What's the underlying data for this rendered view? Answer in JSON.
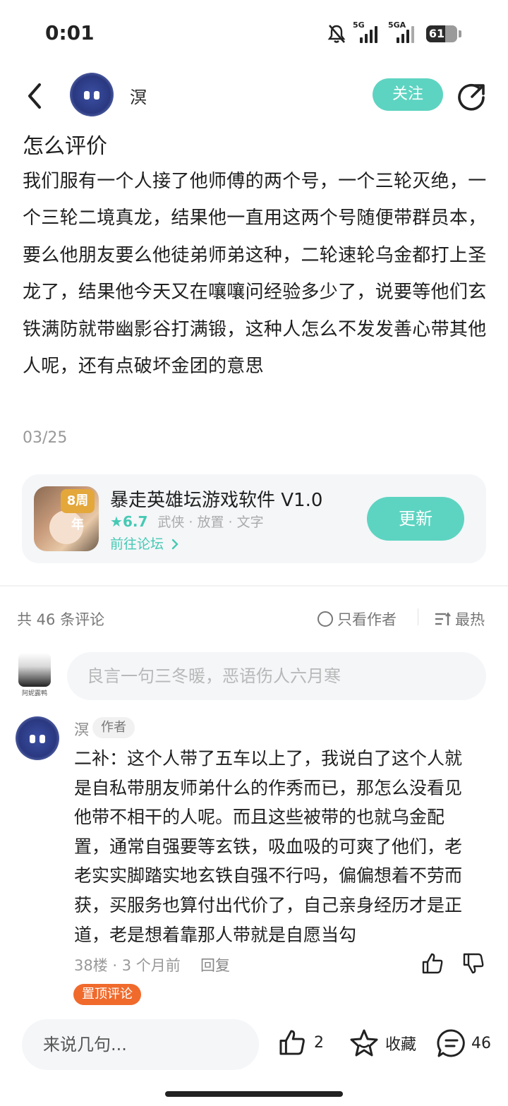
{
  "status_bar": {
    "time": "0:01",
    "signal1_label": "5G",
    "signal2_label": "5GA",
    "battery_level": "61"
  },
  "header": {
    "username": "溟",
    "follow_label": "关注"
  },
  "post": {
    "title": "怎么评价",
    "body": "我们服有一个人接了他师傅的两个号，一个三轮灭绝，一个三轮二境真龙，结果他一直用这两个号随便带群员本，要么他朋友要么他徒弟师弟这种，二轮速轮乌金都打上圣龙了，结果他今天又在嚷嚷问经验多少了，说要等他们玄铁满防就带幽影谷打满锻，这种人怎么不发发善心带其他人呢，还有点破坏金团的意思",
    "date": "03/25"
  },
  "app_card": {
    "badge_text": "8周年",
    "name": "暴走英雄坛游戏软件 V1.0",
    "rating": "6.7",
    "tags": "武侠 · 放置 · 文字",
    "link_label": "前往论坛",
    "update_label": "更新"
  },
  "comments_header": {
    "count_label": "共 46 条评论",
    "only_author_label": "只看作者",
    "sort_label": "最热"
  },
  "comment_input": {
    "avatar_caption": "阿妮露鸭",
    "placeholder": "良言一句三冬暖，恶语伤人六月寒"
  },
  "comment": {
    "username": "溟",
    "author_tag": "作者",
    "body": "二补：这个人带了五车以上了，我说白了这个人就是自私带朋友师弟什么的作秀而已，那怎么没看见他带不相干的人呢。而且这些被带的也就乌金配置，通常自强要等玄铁，吸血吸的可爽了他们，老老实实脚踏实地玄铁自强不行吗，偏偏想着不劳而获，买服务也算付出代价了，自己亲身经历才是正道，老是想着靠那人带就是自愿当勾",
    "meta": "38楼 · 3 个月前",
    "reply_label": "回复",
    "pinned_label": "置顶评论"
  },
  "bottom_bar": {
    "input_placeholder": "来说几句...",
    "like_count": "2",
    "favorite_label": "收藏",
    "comment_count": "46"
  },
  "colors": {
    "accent": "#5dd4c1",
    "link": "#46c9b4",
    "pinned": "#f06a2c"
  },
  "icons": [
    "back-arrow-icon",
    "share-icon",
    "star-icon",
    "chevron-right-icon",
    "radio-circle-icon",
    "sort-lines-icon",
    "thumbs-up-icon",
    "thumbs-down-icon",
    "favorite-star-icon",
    "comment-bubble-icon",
    "bell-muted-icon"
  ]
}
